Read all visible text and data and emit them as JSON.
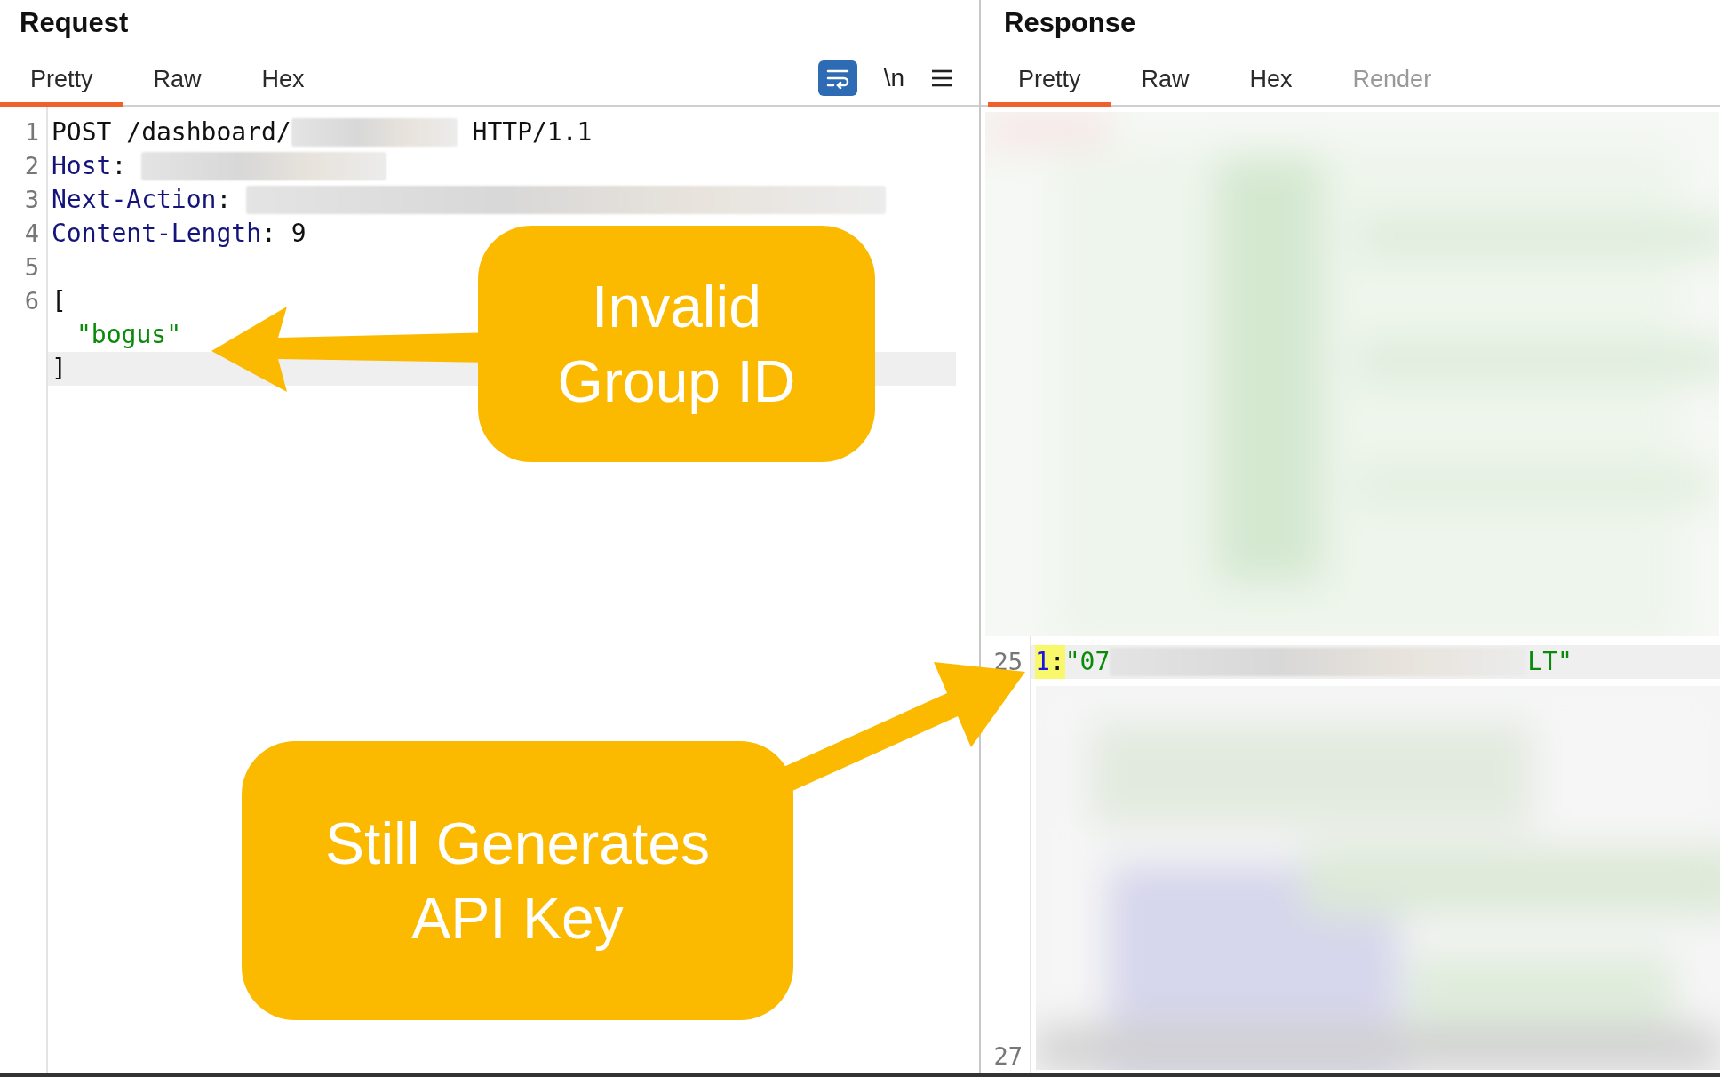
{
  "request": {
    "title": "Request",
    "tabs": [
      {
        "label": "Pretty",
        "selected": true,
        "disabled": false
      },
      {
        "label": "Raw",
        "selected": false,
        "disabled": false
      },
      {
        "label": "Hex",
        "selected": false,
        "disabled": false
      }
    ],
    "toolbar": {
      "wrap_on": true,
      "newline_label": "\\n"
    },
    "lines": [
      {
        "number": "1",
        "highlighted": false,
        "parts": [
          {
            "kind": "plain",
            "text": "POST /dashboard/"
          },
          {
            "kind": "redacted"
          },
          {
            "kind": "plain",
            "text": " HTTP/1.1"
          }
        ]
      },
      {
        "number": "2",
        "highlighted": false,
        "parts": [
          {
            "kind": "key",
            "text": "Host"
          },
          {
            "kind": "plain",
            "text": ": "
          },
          {
            "kind": "redacted"
          }
        ]
      },
      {
        "number": "3",
        "highlighted": false,
        "parts": [
          {
            "kind": "key",
            "text": "Next-Action"
          },
          {
            "kind": "plain",
            "text": ": "
          },
          {
            "kind": "redacted"
          }
        ]
      },
      {
        "number": "4",
        "highlighted": false,
        "parts": [
          {
            "kind": "key",
            "text": "Content-Length"
          },
          {
            "kind": "plain",
            "text": ": 9"
          }
        ]
      },
      {
        "number": "5",
        "highlighted": false
      },
      {
        "number": "6",
        "highlighted": false,
        "parts": [
          {
            "kind": "plain",
            "text": "["
          }
        ],
        "children": [
          {
            "highlighted": false,
            "parts": [
              {
                "kind": "string",
                "text": "\"bogus\""
              }
            ]
          }
        ]
      },
      {
        "highlighted": true,
        "parts": [
          {
            "kind": "plain",
            "text": "]"
          }
        ]
      }
    ]
  },
  "response": {
    "title": "Response",
    "tabs": [
      {
        "label": "Pretty",
        "selected": true,
        "disabled": false
      },
      {
        "label": "Raw",
        "selected": false,
        "disabled": false
      },
      {
        "label": "Hex",
        "selected": false,
        "disabled": false
      },
      {
        "label": "Render",
        "selected": false,
        "disabled": true
      }
    ],
    "lines": [
      {
        "number": "25",
        "highlighted": true,
        "parts": [
          {
            "kind": "number",
            "text": "1",
            "marked": true
          },
          {
            "kind": "plain",
            "text": ":",
            "marked": true
          },
          {
            "kind": "string",
            "text": "\"07",
            "marked": false
          },
          {
            "kind": "redacted"
          },
          {
            "kind": "string",
            "text": "LT\"",
            "marked": false
          }
        ]
      }
    ],
    "last_line_number": "27"
  },
  "callouts": [
    {
      "text": "Invalid Group ID"
    },
    {
      "text": "Still Generates API Key"
    }
  ]
}
